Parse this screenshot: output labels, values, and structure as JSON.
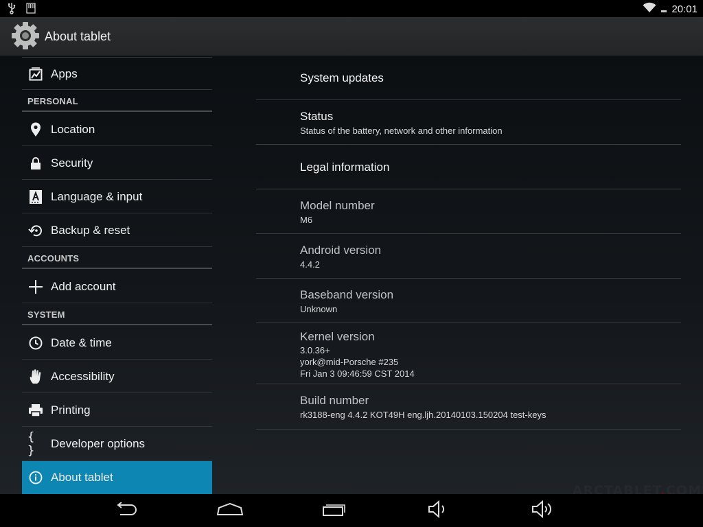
{
  "status_bar": {
    "time": "20:01"
  },
  "action_bar": {
    "title": "About tablet"
  },
  "sidebar": {
    "apps": {
      "label": "Apps",
      "icon": "apps-icon"
    },
    "personal_header": "PERSONAL",
    "personal": [
      {
        "label": "Location",
        "icon": "location-pin-icon"
      },
      {
        "label": "Security",
        "icon": "lock-icon"
      },
      {
        "label": "Language & input",
        "icon": "keyboard-a-icon"
      },
      {
        "label": "Backup & reset",
        "icon": "backup-restore-icon"
      }
    ],
    "accounts_header": "ACCOUNTS",
    "add_account": {
      "label": "Add account",
      "icon": "plus-icon"
    },
    "system_header": "SYSTEM",
    "system": [
      {
        "label": "Date & time",
        "icon": "clock-icon"
      },
      {
        "label": "Accessibility",
        "icon": "hand-icon"
      },
      {
        "label": "Printing",
        "icon": "printer-icon"
      },
      {
        "label": "Developer options",
        "icon": "braces-icon"
      },
      {
        "label": "About tablet",
        "icon": "info-icon",
        "selected": true
      }
    ]
  },
  "detail": {
    "system_updates": {
      "title": "System updates"
    },
    "status": {
      "title": "Status",
      "summary": "Status of the battery, network and other information"
    },
    "legal": {
      "title": "Legal information"
    },
    "model": {
      "title": "Model number",
      "value": "M6"
    },
    "android": {
      "title": "Android version",
      "value": "4.4.2"
    },
    "baseband": {
      "title": "Baseband version",
      "value": "Unknown"
    },
    "kernel": {
      "title": "Kernel version",
      "line1": "3.0.36+",
      "line2": "york@mid-Porsche #235",
      "line3": "Fri Jan 3 09:46:59 CST 2014"
    },
    "build": {
      "title": "Build number",
      "value": "rk3188-eng 4.4.2 KOT49H eng.ljh.20140103.150204 test-keys"
    }
  },
  "nav_bar": {
    "buttons": [
      "back-icon",
      "home-icon",
      "recents-icon",
      "volume-down-icon",
      "volume-up-icon"
    ]
  },
  "watermark": {
    "text_a": "ARCTABLET",
    "text_b": ".",
    "text_c": "COM"
  },
  "colors": {
    "accent_selected": "#0e86b3",
    "background": "#0b0d0f"
  }
}
